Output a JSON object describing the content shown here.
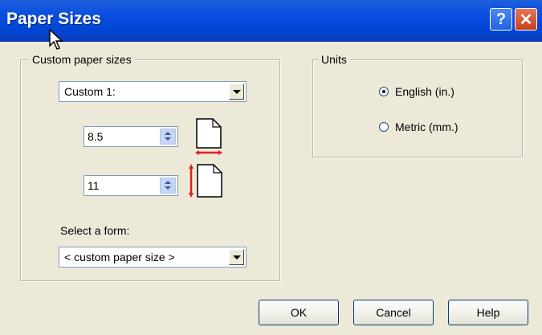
{
  "window": {
    "title": "Paper Sizes",
    "help_glyph": "?",
    "close_glyph": "✕"
  },
  "custom_group": {
    "label": "Custom paper sizes",
    "paper_select": "Custom 1:",
    "width_value": "8.5",
    "height_value": "11",
    "select_form_label": "Select a form:",
    "form_select": "< custom paper size >"
  },
  "units_group": {
    "label": "Units",
    "english_label": "English (in.)",
    "english_checked": true,
    "metric_label": "Metric (mm.)",
    "metric_checked": false
  },
  "buttons": {
    "ok": "OK",
    "cancel": "Cancel",
    "help": "Help"
  },
  "colors": {
    "titlebar": "#0046D5",
    "face": "#ECE9D8",
    "dimension_arrow": "#E02020"
  }
}
